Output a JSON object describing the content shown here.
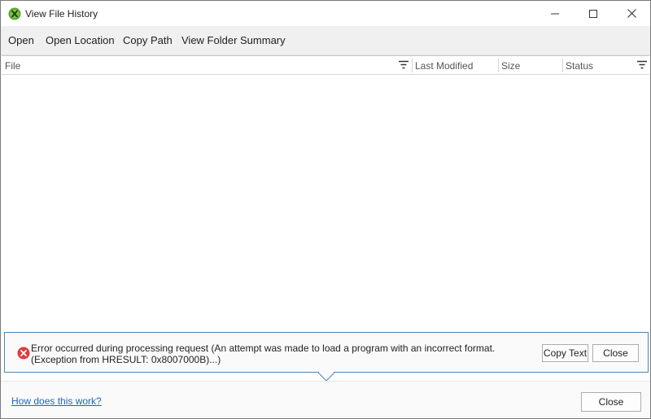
{
  "window": {
    "title": "View File History",
    "controls": {
      "minimize_icon": "minimize-icon",
      "maximize_icon": "maximize-icon",
      "close_icon": "close-icon"
    }
  },
  "menu": {
    "items": [
      {
        "label": "Open"
      },
      {
        "label": "Open Location"
      },
      {
        "label": "Copy Path"
      },
      {
        "label": "View Folder Summary"
      }
    ]
  },
  "grid": {
    "columns": [
      {
        "label": "File",
        "has_filter": true
      },
      {
        "label": "Last Modified",
        "has_filter": false
      },
      {
        "label": "Size",
        "has_filter": false
      },
      {
        "label": "Status",
        "has_filter": true
      }
    ],
    "rows": []
  },
  "error": {
    "icon": "error-icon",
    "message": "Error occurred during processing request (An attempt was made to load a program with an incorrect format. (Exception from HRESULT: 0x8007000B)...)",
    "copy_label": "Copy Text",
    "close_label": "Close"
  },
  "footer": {
    "help_link": "How does this work?",
    "close_label": "Close"
  },
  "colors": {
    "accent": "#4d86b8",
    "link": "#1a66c2",
    "error": "#e0393e",
    "app_icon": "#5aa02c"
  }
}
